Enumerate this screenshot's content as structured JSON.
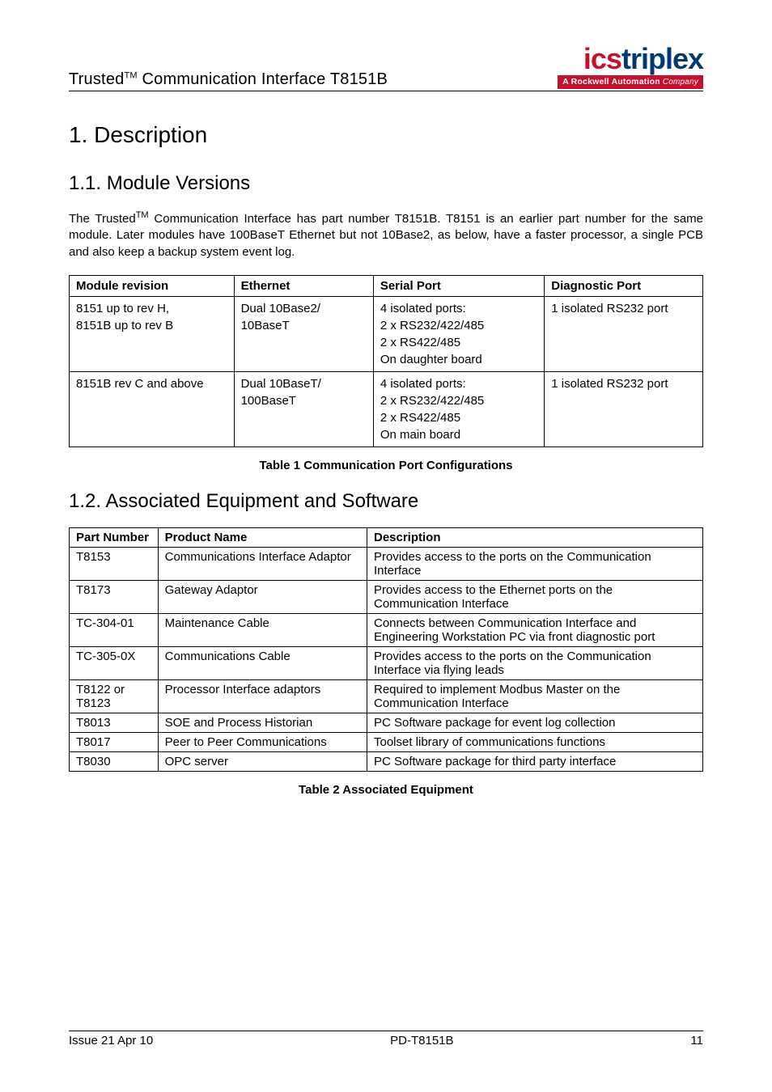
{
  "header": {
    "title_prefix": "Trusted",
    "title_sup": "TM",
    "title_suffix": " Communication Interface T8151B",
    "logo_ics": "ics",
    "logo_trip": "triplex",
    "logo_sub_strong": "A Rockwell Automation",
    "logo_sub_light": " Company"
  },
  "h1": "1. Description",
  "h2a": "1.1.   Module Versions",
  "para1_pre": "The Trusted",
  "para1_sup": "TM",
  "para1_post": " Communication Interface has part number T8151B. T8151 is an earlier part number for the same module. Later modules have 100BaseT Ethernet but not 10Base2, as below, have a faster processor, a single PCB and also keep a backup system event log.",
  "table1": {
    "headers": [
      "Module revision",
      "Ethernet",
      "Serial Port",
      "Diagnostic Port"
    ],
    "rows": [
      {
        "c0": [
          "8151 up to rev H,",
          "8151B up to rev B"
        ],
        "c1": [
          "Dual 10Base2/",
          "10BaseT"
        ],
        "c2": [
          "4 isolated ports:",
          "2 x RS232/422/485",
          "2 x RS422/485",
          "On daughter board"
        ],
        "c3": [
          "1 isolated RS232 port"
        ]
      },
      {
        "c0": [
          "8151B rev C and above"
        ],
        "c1": [
          "Dual 10BaseT/",
          "100BaseT"
        ],
        "c2": [
          "4 isolated ports:",
          "2 x RS232/422/485",
          "2 x RS422/485",
          "On main board"
        ],
        "c3": [
          "1 isolated RS232 port"
        ]
      }
    ],
    "caption": "Table 1 Communication Port Configurations"
  },
  "h2b": "1.2.   Associated Equipment and Software",
  "table2": {
    "headers": [
      "Part Number",
      "Product Name",
      "Description"
    ],
    "rows": [
      [
        "T8153",
        "Communications Interface Adaptor",
        "Provides access to the ports on the Communication Interface"
      ],
      [
        "T8173",
        "Gateway Adaptor",
        "Provides access to the Ethernet ports on the Communication Interface"
      ],
      [
        "TC-304-01",
        "Maintenance Cable",
        "Connects between Communication Interface and Engineering Workstation PC via front diagnostic port"
      ],
      [
        "TC-305-0X",
        "Communications Cable",
        "Provides access to the ports on the Communication Interface via flying leads"
      ],
      [
        "T8122 or T8123",
        "Processor Interface adaptors",
        "Required to implement Modbus Master on the Communication Interface"
      ],
      [
        "T8013",
        "SOE and Process Historian",
        "PC Software package for event log collection"
      ],
      [
        "T8017",
        "Peer to Peer Communications",
        "Toolset library of communications functions"
      ],
      [
        "T8030",
        "OPC server",
        "PC Software package for third party interface"
      ]
    ],
    "caption": "Table 2 Associated Equipment"
  },
  "footer": {
    "left": "Issue 21 Apr 10",
    "center": "PD-T8151B",
    "right": "11"
  }
}
